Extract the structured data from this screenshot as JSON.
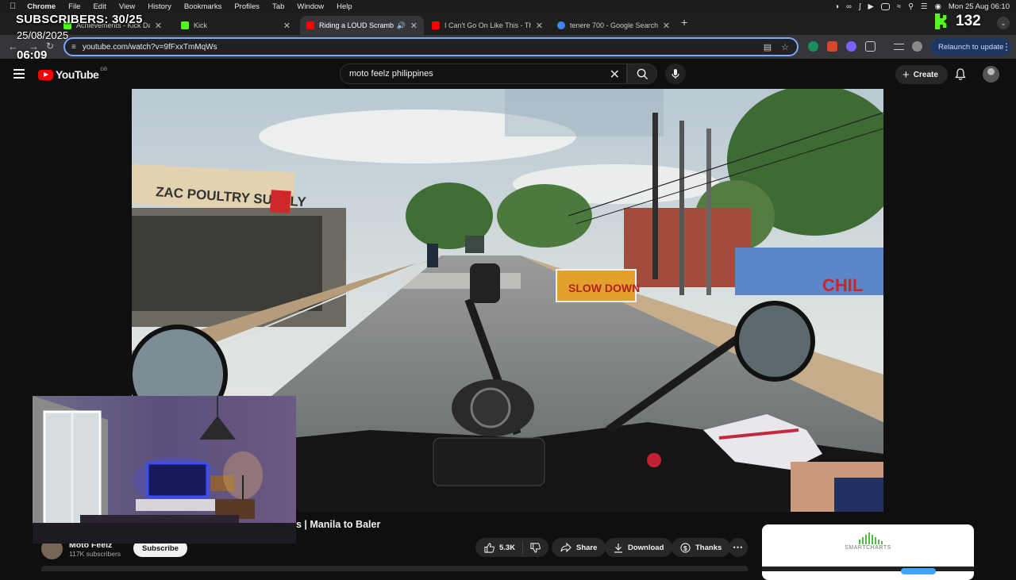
{
  "overlay": {
    "subscribers": "SUBSCRIBERS: 30/25",
    "date": "25/08/2025",
    "clock": "06:09",
    "kick_count": "132"
  },
  "menubar": {
    "app": "Chrome",
    "items": [
      "File",
      "Edit",
      "View",
      "History",
      "Bookmarks",
      "Profiles",
      "Tab",
      "Window",
      "Help"
    ],
    "datetime": "Mon 25 Aug  06:10"
  },
  "tabs": [
    {
      "title": "Achievements - Kick Dashbo",
      "favicon_color": "#53fc18"
    },
    {
      "title": "Kick",
      "favicon_color": "#53fc18"
    },
    {
      "title": "Riding a LOUD Scrambler",
      "favicon_color": "#ff0000",
      "active": true
    },
    {
      "title": "I Can't Go On Like This - The",
      "favicon_color": "#ff0000"
    },
    {
      "title": "tenere 700 - Google Search",
      "favicon_color": "#4285f4"
    }
  ],
  "toolbar": {
    "url": "youtube.com/watch?v=9fFxxTmMqWs",
    "relaunch_label": "Relaunch to update"
  },
  "youtube": {
    "logo_text": "YouTube",
    "country_code": "GB",
    "search_value": "moto feelz philippines",
    "create_label": "Create"
  },
  "video": {
    "title_visible": "s | Manila to Baler",
    "sign_left": "ZAC POULTRY SUPPLY",
    "sign_road": "SLOW DOWN",
    "wall_text": "CHIL"
  },
  "channel": {
    "name": "Moto Feelz",
    "subscribers": "117K subscribers",
    "subscribe_label": "Subscribe"
  },
  "actions": {
    "likes": "5.3K",
    "share": "Share",
    "download": "Download",
    "thanks": "Thanks"
  },
  "ad": {
    "brand": "SMARTCHARTS"
  },
  "colors": {
    "accent": "#ff0000",
    "kick": "#53fc18",
    "focus": "#7ea7f5"
  }
}
